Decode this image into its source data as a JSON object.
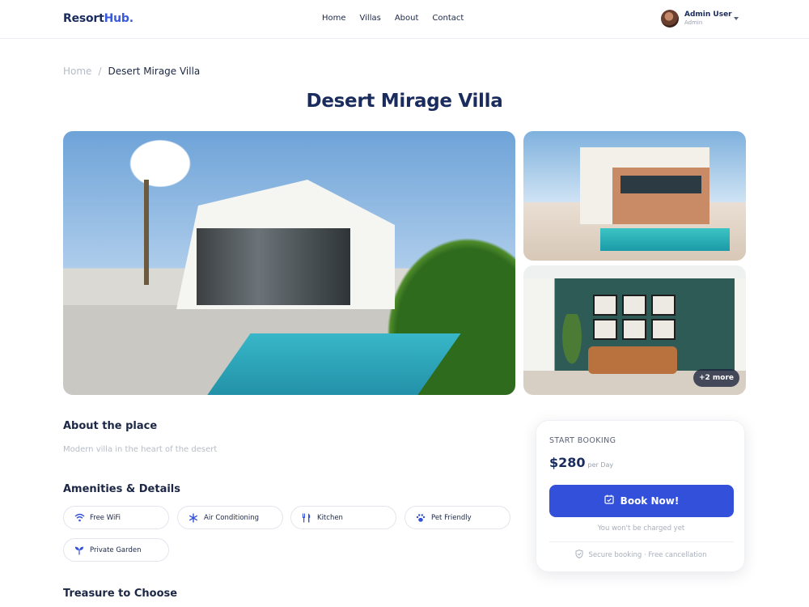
{
  "app": {
    "brand_main": "Resort",
    "brand_accent": "Hub.",
    "accent_color": "#3350db"
  },
  "nav": {
    "items": [
      "Home",
      "Villas",
      "About",
      "Contact"
    ]
  },
  "user": {
    "name": "Admin User",
    "role": "Admin"
  },
  "breadcrumb": {
    "home": "Home",
    "separator": "/",
    "current": "Desert Mirage Villa"
  },
  "page": {
    "title": "Desert Mirage Villa"
  },
  "gallery": {
    "more_label": "+2 more"
  },
  "about": {
    "heading": "About the place",
    "description": "Modern villa in the heart of the desert"
  },
  "amenities": {
    "heading": "Amenities & Details",
    "items": [
      {
        "label": "Free WiFi",
        "icon": "wifi-icon"
      },
      {
        "label": "Air Conditioning",
        "icon": "snowflake-icon"
      },
      {
        "label": "Kitchen",
        "icon": "utensils-icon"
      },
      {
        "label": "Pet Friendly",
        "icon": "paw-icon"
      },
      {
        "label": "Private Garden",
        "icon": "leaf-icon"
      }
    ]
  },
  "treasure": {
    "heading": "Treasure to Choose"
  },
  "booking": {
    "kicker": "START BOOKING",
    "price": "$280",
    "unit": "per Day",
    "button_label": "Book Now!",
    "note": "You won't be charged yet",
    "secure_text": "Secure booking · Free cancellation"
  }
}
